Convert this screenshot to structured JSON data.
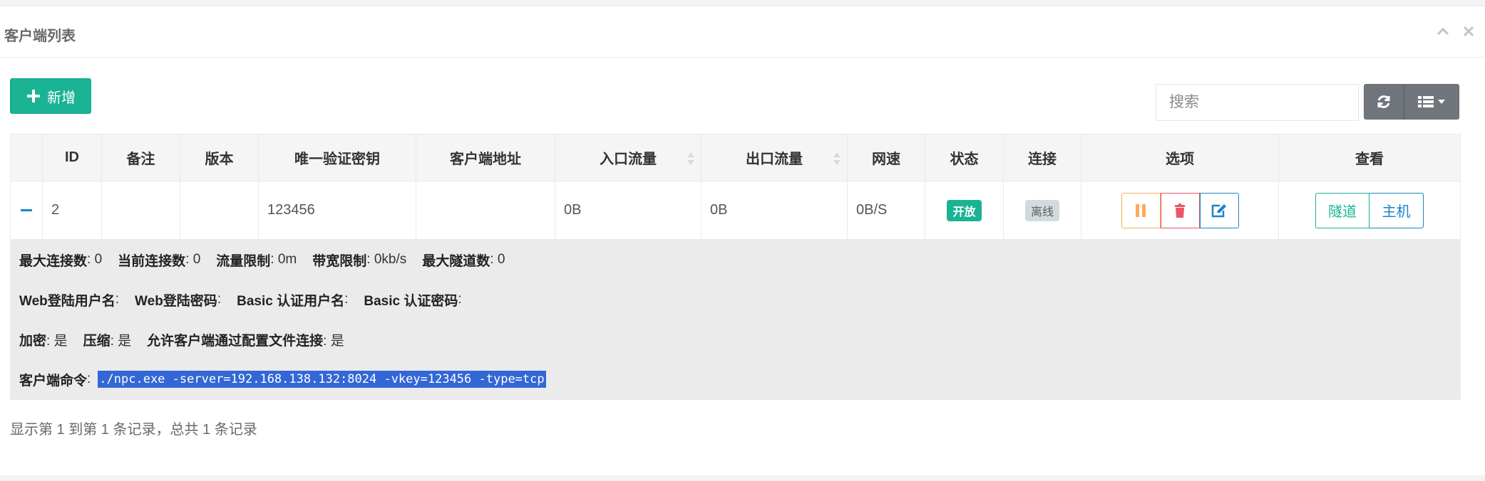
{
  "panel": {
    "title": "客户端列表"
  },
  "toolbar": {
    "add_label": "新增",
    "search_placeholder": "搜索"
  },
  "table": {
    "headers": [
      "",
      "ID",
      "备注",
      "版本",
      "唯一验证密钥",
      "客户端地址",
      "入口流量",
      "出口流量",
      "网速",
      "状态",
      "连接",
      "选项",
      "查看"
    ],
    "row": {
      "id": "2",
      "remark": "",
      "version": "",
      "vkey": "123456",
      "address": "",
      "in_flow": "0B",
      "out_flow": "0B",
      "speed": "0B/S",
      "status": "开放",
      "connection": "离线",
      "view_tunnel": "隧道",
      "view_host": "主机"
    },
    "detail": {
      "max_conn_label": "最大连接数",
      "max_conn_value": ": 0",
      "cur_conn_label": "当前连接数",
      "cur_conn_value": ": 0",
      "flow_limit_label": "流量限制",
      "flow_limit_value": ": 0m",
      "rate_limit_label": "带宽限制",
      "rate_limit_value": ": 0kb/s",
      "max_tunnel_label": "最大隧道数",
      "max_tunnel_value": ": 0",
      "web_user_label": "Web登陆用户名",
      "web_user_value": ":",
      "web_pass_label": "Web登陆密码",
      "web_pass_value": ":",
      "basic_user_label": "Basic 认证用户名",
      "basic_user_value": ":",
      "basic_pass_label": "Basic 认证密码",
      "basic_pass_value": ":",
      "crypt_label": "加密",
      "crypt_value": ": 是",
      "compress_label": "压缩",
      "compress_value": ": 是",
      "config_conn_label": "允许客户端通过配置文件连接",
      "config_conn_value": ": 是",
      "cmd_label": "客户端命令",
      "cmd_colon": ":",
      "cmd_value": "./npc.exe -server=192.168.138.132:8024 -vkey=123456 -type=tcp"
    }
  },
  "pagination": {
    "summary": "显示第 1 到第 1 条记录，总共 1 条记录"
  },
  "colors": {
    "primary": "#1ab394",
    "info": "#1c84c6",
    "warning": "#f8ac59",
    "danger": "#ed5565",
    "grey_button": "#6f757b"
  }
}
